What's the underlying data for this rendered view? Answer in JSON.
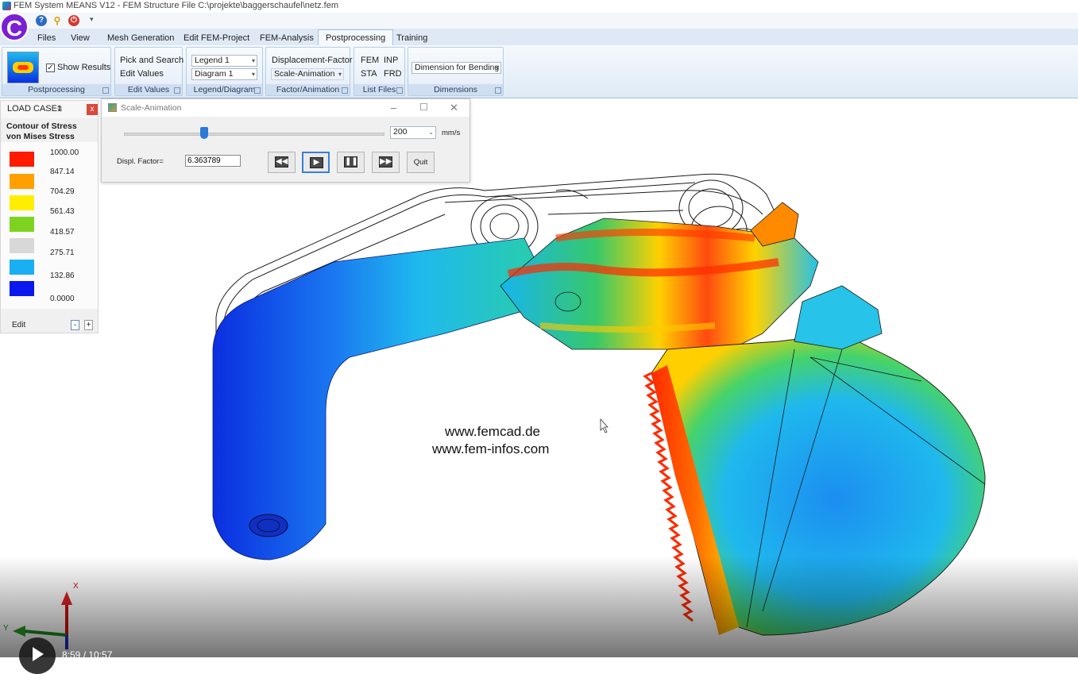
{
  "window": {
    "title": "FEM System MEANS V12 - FEM Structure File C:\\projekte\\baggerschaufel\\netz.fem",
    "logo_letter": "C"
  },
  "qat": [
    "help-icon",
    "key-icon",
    "power-icon"
  ],
  "tabs": [
    {
      "label": "Files"
    },
    {
      "label": "View"
    },
    {
      "label": "Mesh Generation"
    },
    {
      "label": "Edit FEM-Project"
    },
    {
      "label": "FEM-Analysis"
    },
    {
      "label": "Postprocessing",
      "active": true
    },
    {
      "label": "Training"
    }
  ],
  "ribbon": {
    "postprocessing": {
      "show_results": "Show Results",
      "show_results_checked": true,
      "group": "Postprocessing"
    },
    "edit_values": {
      "pick_and_search": "Pick and Search",
      "edit_values": "Edit Values",
      "group": "Edit Values"
    },
    "legend_diagram": {
      "legend": "Legend 1",
      "diagram": "Diagram 1",
      "group": "Legend/Diagram"
    },
    "factor_animation": {
      "displacement_factor": "Displacement-Factor",
      "scale_animation": "Scale-Animation",
      "group": "Factor/Animation"
    },
    "list_files": {
      "fem": "FEM",
      "inp": "INP",
      "sta": "STA",
      "frd": "FRD",
      "group": "List Files"
    },
    "dimensions": {
      "combo": "Dimension for Bending",
      "group": "Dimensions"
    }
  },
  "legend": {
    "load_case_label": "LOAD CASE=",
    "load_case_value": "1",
    "close": "x",
    "title_line1": "Contour of Stress",
    "title_line2": "von Mises Stress",
    "entries": [
      {
        "value": "1000.00",
        "color": "#ff1a00"
      },
      {
        "value": "847.14",
        "color": "#ffa000"
      },
      {
        "value": "704.29",
        "color": "#ffee00"
      },
      {
        "value": "561.43",
        "color": "#7ed321"
      },
      {
        "value": "418.57",
        "color": "#d8d8d8"
      },
      {
        "value": "275.71",
        "color": "#1aaef2"
      },
      {
        "value": "132.86",
        "color": "#0a18ee"
      },
      {
        "value": "0.0000",
        "color": null
      }
    ],
    "edit_label": "Edit",
    "minus": "-",
    "plus": "+"
  },
  "dialog": {
    "title": "Scale-Animation",
    "slider_fraction": 0.31,
    "speed_value": "200",
    "speed_unit": "mm/s",
    "displ_factor_label": "Displ. Factor=",
    "displ_factor_value": "6.363789",
    "quit_label": "Quit"
  },
  "watermark": {
    "line1": "www.femcad.de",
    "line2": "www.fem-infos.com"
  },
  "axes": {
    "x": "X",
    "y": "Y"
  },
  "video": {
    "timecode": "8:59 / 10:57"
  }
}
